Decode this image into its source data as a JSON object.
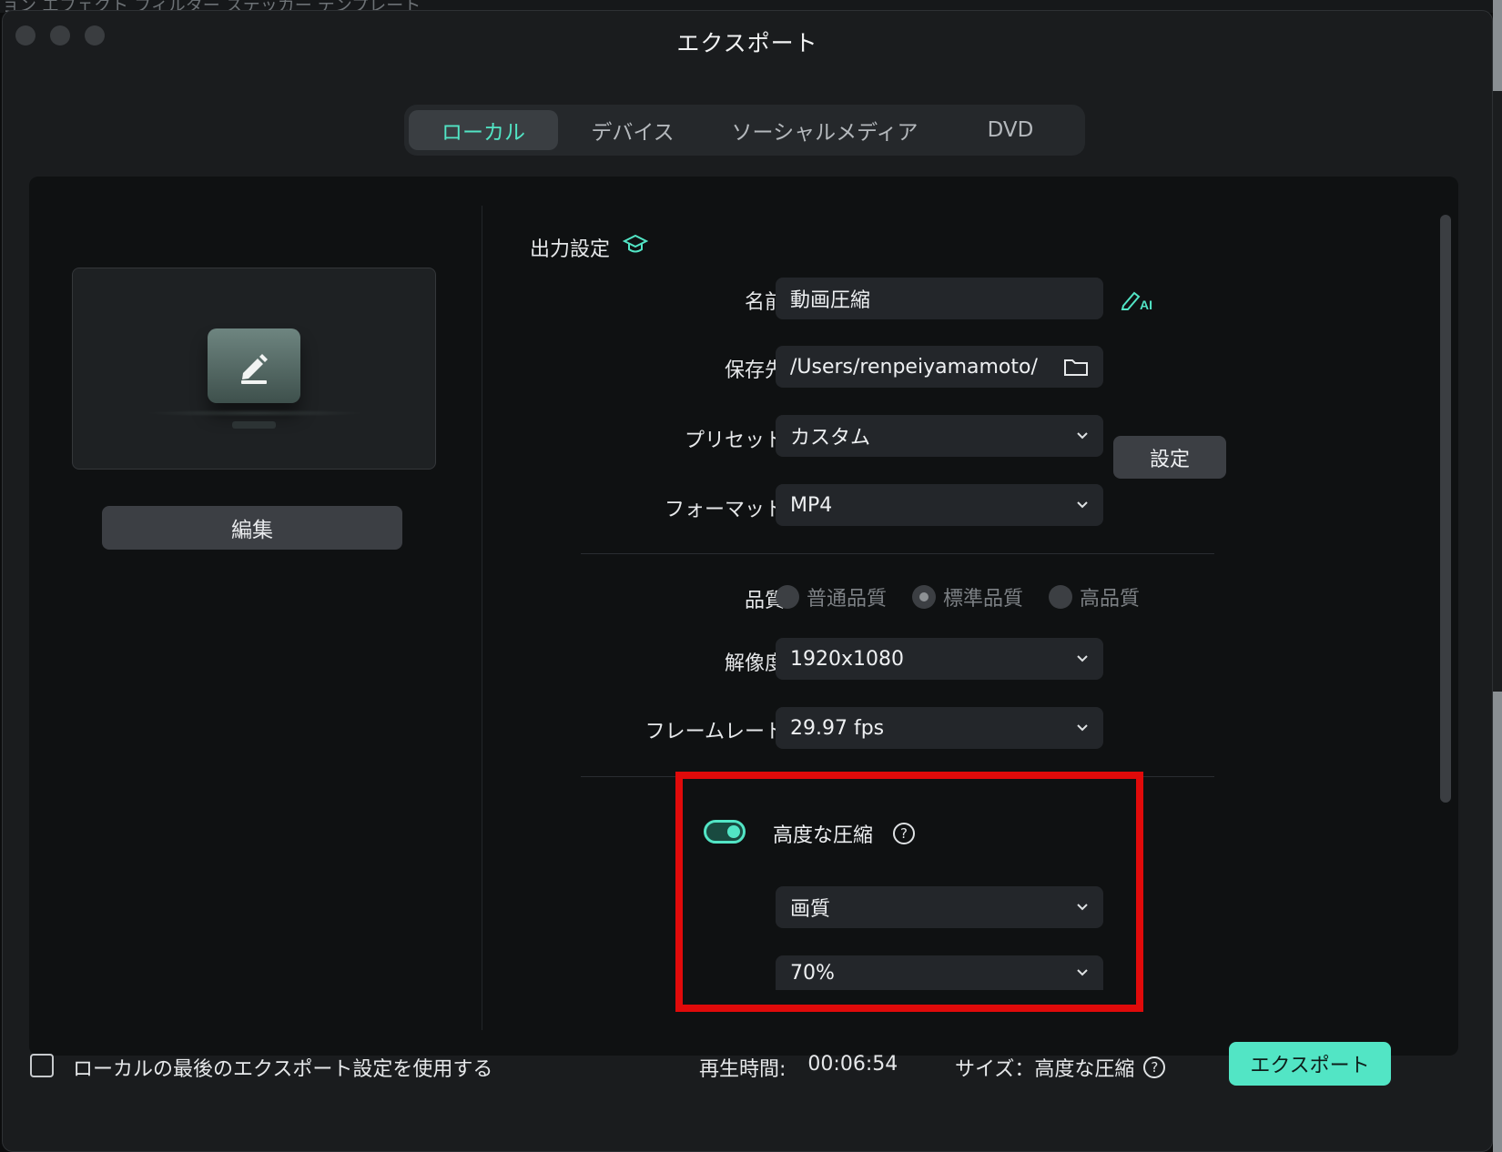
{
  "window": {
    "background_strip_text": "ョン エフェクト フィルター ステッカー テンプレート",
    "title": "エクスポート"
  },
  "tabs": [
    {
      "label": "ローカル",
      "active": true
    },
    {
      "label": "デバイス",
      "active": false
    },
    {
      "label": "ソーシャルメディア",
      "active": false
    },
    {
      "label": "DVD",
      "active": false
    }
  ],
  "preview": {
    "edit_label": "編集"
  },
  "output": {
    "section_title": "出力設定",
    "name_label": "名前",
    "name_value": "動画圧縮",
    "save_label": "保存先",
    "save_value": "/Users/renpeiyamamoto/",
    "preset_label": "プリセット",
    "preset_value": "カスタム",
    "preset_settings_button": "設定",
    "format_label": "フォーマット",
    "format_value": "MP4",
    "quality_label": "品質",
    "quality_options": [
      {
        "label": "普通品質",
        "selected": false
      },
      {
        "label": "標準品質",
        "selected": true
      },
      {
        "label": "高品質",
        "selected": false
      }
    ],
    "resolution_label": "解像度",
    "resolution_value": "1920x1080",
    "framerate_label": "フレームレート",
    "framerate_value": "29.97 fps"
  },
  "compression": {
    "enabled": true,
    "label": "高度な圧縮",
    "help": "?",
    "mode_value": "画質",
    "percent_value": "70%"
  },
  "footer": {
    "use_last_label": "ローカルの最後のエクスポート設定を使用する",
    "duration_label": "再生時間:",
    "duration_value": "00:06:54",
    "size_label": "サイズ：高度な圧縮",
    "size_help": "?",
    "export_button": "エクスポート"
  },
  "colors": {
    "accent": "#52e5c5",
    "highlight_box": "#e00a0a"
  }
}
